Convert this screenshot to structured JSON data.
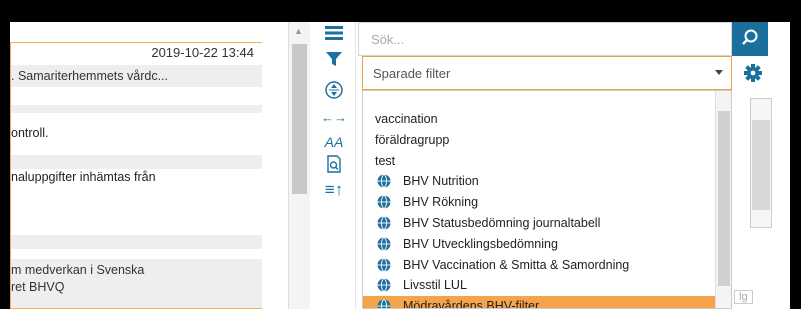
{
  "journal": {
    "date": "2019-10-22 13:44",
    "rows": [
      ". Samariterhemmets vårdc...",
      "ontroll.",
      "naluppgifter inhämtas från",
      "m medverkan i Svenska",
      "ret BHVQ"
    ]
  },
  "tools": {
    "list_icon": "list-icon",
    "filter_icon": "filter-icon",
    "expand_icon": "expand-vertical-icon",
    "arrows_icon": "horizontal-arrows-icon",
    "font_icon": "font-size-icon",
    "search_doc_icon": "document-search-icon",
    "sort_icon": "sort-up-icon"
  },
  "search": {
    "placeholder": "Sök..."
  },
  "filter": {
    "placeholder": "Sparade filter",
    "options": [
      {
        "label": "vaccination",
        "icon": false
      },
      {
        "label": "föräldragrupp",
        "icon": false
      },
      {
        "label": "test",
        "icon": false
      },
      {
        "label": "BHV Nutrition",
        "icon": true
      },
      {
        "label": "BHV Rökning",
        "icon": true
      },
      {
        "label": "BHV Statusbedömning journaltabell",
        "icon": true
      },
      {
        "label": "BHV Utvecklingsbedömning",
        "icon": true
      },
      {
        "label": "BHV Vaccination & Smitta & Samordning",
        "icon": true
      },
      {
        "label": "Livsstil LUL",
        "icon": true
      },
      {
        "label": "Mödravårdens BHV-filter",
        "icon": true,
        "selected": true
      }
    ]
  },
  "right": {
    "partial_text": "lg"
  },
  "colors": {
    "accent": "#1a6f9c",
    "highlight": "#f5a44b",
    "border_orange": "#f0a040"
  }
}
